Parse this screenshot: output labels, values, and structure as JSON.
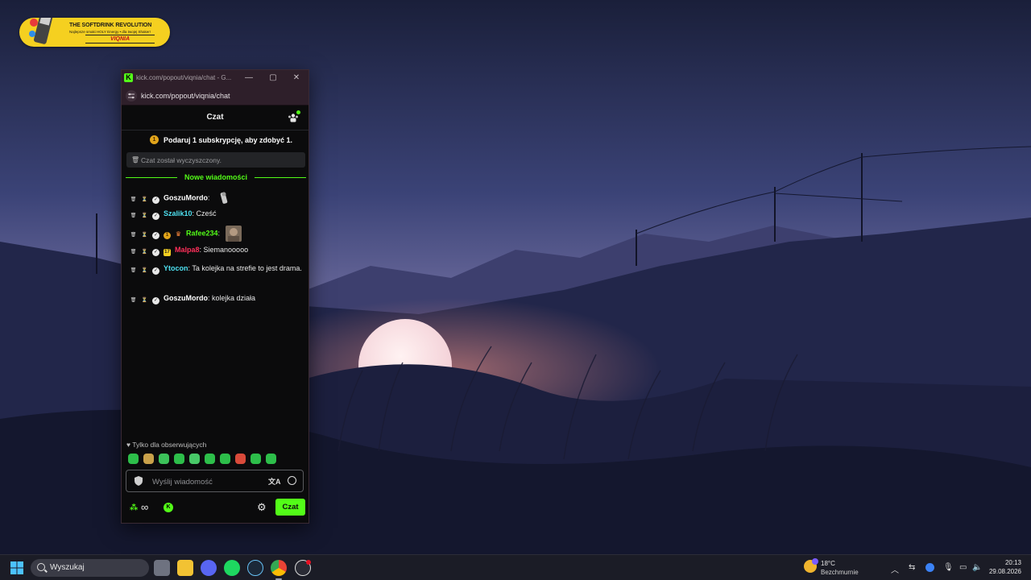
{
  "desktop": {
    "logo": {
      "line1": "THE SOFTDRINK REVOLUTION",
      "line2": "Najlepsze smaki HOLY Energy • dla twojej Shaker!",
      "line3": "VIQNIA"
    }
  },
  "window": {
    "title": "kick.com/popout/viqnia/chat - G...",
    "url": "kick.com/popout/viqnia/chat",
    "controls": {
      "minimize": "—",
      "maximize": "▢",
      "close": "✕"
    }
  },
  "chat": {
    "header_title": "Czat",
    "promo": "Podaruj 1 subskrypcję, aby zdobyć 1.",
    "promo_coin": "1",
    "cleared_notice": "Czat został wyczyszczony.",
    "new_messages_label": "Nowe wiadomości",
    "messages": [
      {
        "user": "GoszuMordo",
        "sep": ":",
        "text": "",
        "color": "#ffffff"
      },
      {
        "user": "Szalik10",
        "sep": ":",
        "text": " Cześć",
        "color": "#4ee0f0"
      },
      {
        "user": "Rafee234",
        "sep": ":",
        "text": "",
        "color": "#53fc18",
        "sub_badge": "1"
      },
      {
        "user": "Malpa8",
        "sep": ":",
        "text": " Siemanooooo",
        "color": "#ff2f5a",
        "age_badge": "17"
      },
      {
        "user": "Ytocon",
        "sep": ":",
        "text": " Ta kolejka na strefie to jest drama.",
        "color": "#4ee0f0"
      },
      {
        "user": "GoszuMordo",
        "sep": ":",
        "text": " kolejka działa",
        "color": "#ffffff"
      }
    ],
    "followers_only": "Tylko dla obserwujących",
    "input_placeholder": "Wyślij wiadomość",
    "translate_icon": "文A",
    "points": "∞",
    "send_label": "Czat"
  },
  "taskbar": {
    "search_label": "Wyszukaj",
    "weather_temp": "18°C",
    "weather_cond": "Bezchmurnie",
    "time": "20:13",
    "date": "29.08.2026"
  },
  "colors": {
    "kick_green": "#53fc18",
    "chat_bg": "#0b0b0c",
    "titlebar": "#2e1f2a"
  }
}
